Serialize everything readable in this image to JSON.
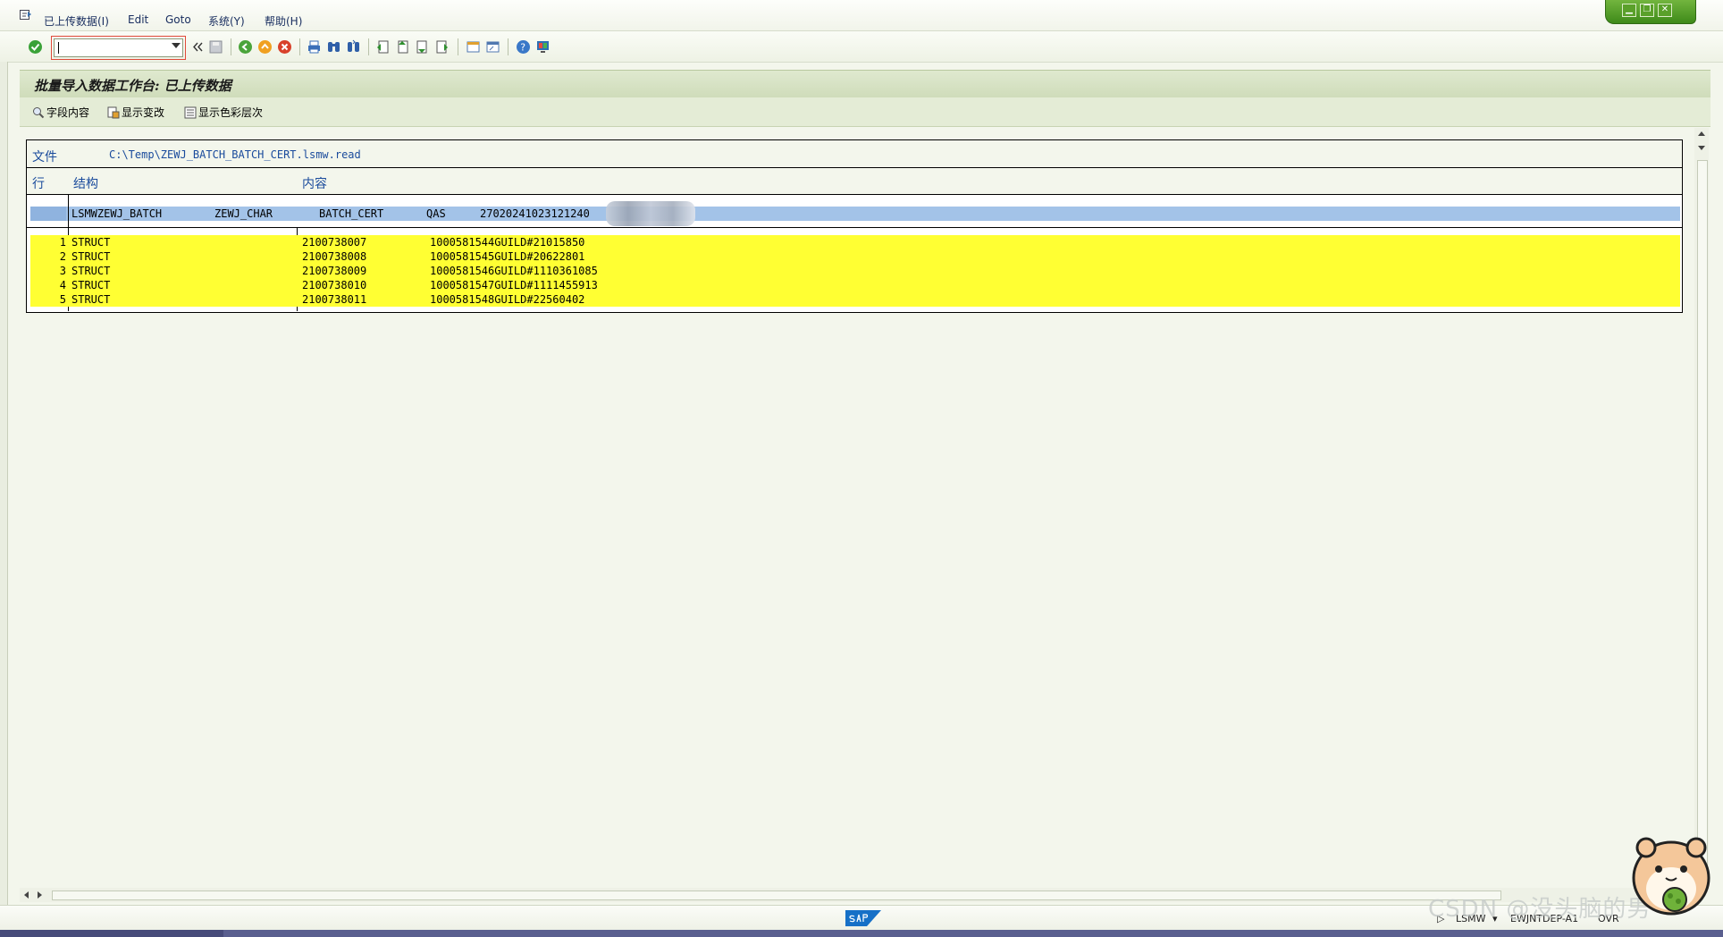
{
  "menubar": {
    "items": [
      "已上传数据(I)",
      "Edit",
      "Goto",
      "系统(Y)",
      "帮助(H)"
    ]
  },
  "window_controls": [
    "▁",
    "❐",
    "✕"
  ],
  "toolbar": {
    "command_field_value": "",
    "icons": [
      "check-icon",
      "back-icon",
      "save-icon",
      "nav-back-icon",
      "nav-exit-icon",
      "cancel-icon",
      "print-icon",
      "find-icon",
      "find-next-icon",
      "first-page-icon",
      "prev-page-icon",
      "next-page-icon",
      "last-page-icon",
      "new-session-icon",
      "shortcut-icon",
      "help-icon",
      "layout-icon"
    ]
  },
  "page": {
    "title": "批量导入数据工作台: 已上传数据"
  },
  "app_toolbar": {
    "field_content": "字段内容",
    "show_changes": "显示变改",
    "show_color_levels": "显示色彩层次"
  },
  "content": {
    "file_label": "文件",
    "file_path": "C:\\Temp\\ZEWJ_BATCH_BATCH_CERT.lsmw.read",
    "col_row": "行",
    "col_struct": "结构",
    "col_content": "内容",
    "header_row": {
      "a": "LSMWZEWJ_BATCH",
      "b": "ZEWJ_CHAR",
      "c": "BATCH_CERT",
      "d": "QAS",
      "e": "27020241023121240"
    },
    "rows": [
      {
        "n": "1",
        "struct": "STRUCT",
        "c1": "2100738007",
        "c2": "1000581544GUILD#21015850"
      },
      {
        "n": "2",
        "struct": "STRUCT",
        "c1": "2100738008",
        "c2": "1000581545GUILD#20622801"
      },
      {
        "n": "3",
        "struct": "STRUCT",
        "c1": "2100738009",
        "c2": "1000581546GUILD#1110361085"
      },
      {
        "n": "4",
        "struct": "STRUCT",
        "c1": "2100738010",
        "c2": "1000581547GUILD#1111455913"
      },
      {
        "n": "5",
        "struct": "STRUCT",
        "c1": "2100738011",
        "c2": "1000581548GUILD#22560402"
      }
    ]
  },
  "statusbar": {
    "transaction": "LSMW",
    "system": "EWJNTDEP-A1",
    "mode": "OVR"
  },
  "watermark": "CSDN @没头脑的男",
  "colors": {
    "highlight_yellow": "#ffff33",
    "header_blue": "#a3c3e8",
    "sap_green": "#3e8a19"
  }
}
